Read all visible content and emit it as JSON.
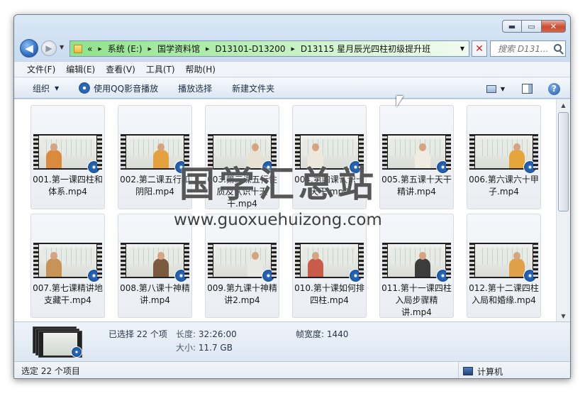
{
  "window": {
    "minimize_glyph": "▬",
    "maximize_glyph": "▭",
    "close_glyph": "✕"
  },
  "nav": {
    "back_glyph": "◀",
    "forward_glyph": "▶",
    "overflow": "«",
    "crumbs": [
      "系统 (E:)",
      "国学资料馆",
      "D13101-D13200",
      "D13115 星月辰光四柱初级提升班"
    ],
    "search_placeholder": "搜索 D131..."
  },
  "menu": [
    "文件(F)",
    "编辑(E)",
    "查看(V)",
    "工具(T)",
    "帮助(H)"
  ],
  "toolbar": {
    "organize": "组织",
    "play_qq": "使用QQ影音播放",
    "play_selected": "播放选择",
    "new_folder": "新建文件夹",
    "help_glyph": "?"
  },
  "files": [
    {
      "name": "001.第一课四柱和体系.mp4",
      "shirt": "#d98a3c"
    },
    {
      "name": "002.第二课五行和阴阳.mp4",
      "shirt": "#e3a23d"
    },
    {
      "name": "003.第三课五行性质及认识十天干.mp4",
      "shirt": "#e8e2d4"
    },
    {
      "name": "004.第四课认识十天干.mp4",
      "shirt": "#ece8dc"
    },
    {
      "name": "005.第五课十天干精讲.mp4",
      "shirt": "#f0ece2"
    },
    {
      "name": "006.第六课六十甲子.mp4",
      "shirt": "#e6a53a"
    },
    {
      "name": "007.第七课精讲地支藏干.mp4",
      "shirt": "#c79357"
    },
    {
      "name": "008.第八课十神精讲.mp4",
      "shirt": "#7c5a40"
    },
    {
      "name": "009.第九课十神精讲2.mp4",
      "shirt": "#e9e9e4"
    },
    {
      "name": "010.第十课如何排四柱.mp4",
      "shirt": "#c95b4a"
    },
    {
      "name": "011.第十一课四柱入局步骤精讲.mp4",
      "shirt": "#3c3c3c"
    },
    {
      "name": "012.第十二课四柱入局和婚缘.mp4",
      "shirt": "#e0a04a"
    }
  ],
  "watermark": {
    "cn": "国学汇总站",
    "url": "www.guoxuehuizong.com"
  },
  "details": {
    "selected": "已选择 22 个项",
    "length_label": "长度:",
    "length_value": "32:26:00",
    "size_label": "大小:",
    "size_value": "11.7 GB",
    "frame_width_label": "帧宽度:",
    "frame_width_value": "1440"
  },
  "status": {
    "left": "选定 22 个项目",
    "right": "计算机"
  }
}
